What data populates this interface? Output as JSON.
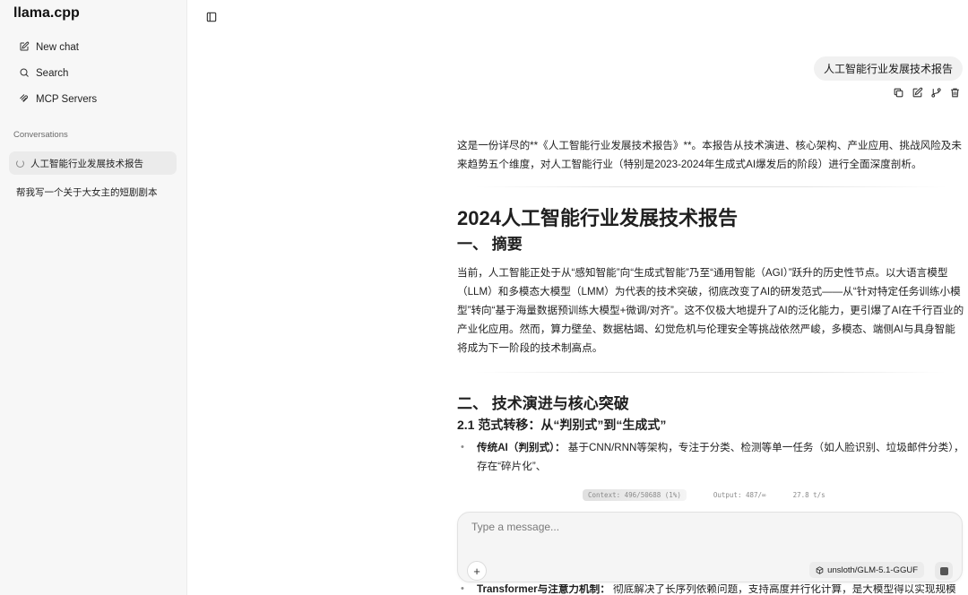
{
  "app": {
    "title": "llama.cpp"
  },
  "sidebar": {
    "nav": [
      {
        "label": "New chat",
        "icon": "edit-icon"
      },
      {
        "label": "Search",
        "icon": "search-icon"
      },
      {
        "label": "MCP Servers",
        "icon": "mcp-icon"
      }
    ],
    "section_label": "Conversations",
    "conversations": [
      {
        "title": "人工智能行业发展技术报告",
        "active": true
      },
      {
        "title": "帮我写一个关于大女主的短剧剧本",
        "active": false
      }
    ]
  },
  "chat": {
    "user_message": "人工智能行业发展技术报告",
    "assistant": {
      "intro": "这是一份详尽的**《人工智能行业发展技术报告》**。本报告从技术演进、核心架构、产业应用、挑战风险及未来趋势五个维度，对人工智能行业（特别是2023-2024年生成式AI爆发后的阶段）进行全面深度剖析。",
      "title": "2024人工智能行业发展技术报告",
      "section1_heading": "一、 摘要",
      "section1_body": "当前，人工智能正处于从“感知智能”向“生成式智能”乃至“通用智能（AGI）”跃升的历史性节点。以大语言模型（LLM）和多模态大模型（LMM）为代表的技术突破，彻底改变了AI的研发范式——从“针对特定任务训练小模型”转向“基于海量数据预训练大模型+微调/对齐”。这不仅极大地提升了AI的泛化能力，更引爆了AI在千行百业的产业化应用。然而，算力壁垒、数据枯竭、幻觉危机与伦理安全等挑战依然严峻，多模态、端侧AI与具身智能将成为下一阶段的技术制高点。",
      "section2_heading": "二、 技术演进与核心突破",
      "sub21_heading": "2.1 范式转移：从“判别式”到“生成式”",
      "bullet1_bold": "传统AI（判别式）：",
      "bullet1_text": " 基于CNN/RNN等架构，专注于分类、检测等单一任务（如人脸识别、垃圾邮件分类），存在“碎片化”、",
      "bullet2_bold": "Transformer与注意力机制：",
      "bullet2_text": " 彻底解决了长序列依赖问题，支持高度并行化计算，是大模型得以实现规模"
    },
    "stats": {
      "context": "Context: 496/50688 (1%)",
      "output": "Output: 487/∞",
      "speed": "27.8 t/s"
    }
  },
  "composer": {
    "placeholder": "Type a message...",
    "model": "unsloth/GLM-5.1-GGUF",
    "attach_label": "+"
  }
}
